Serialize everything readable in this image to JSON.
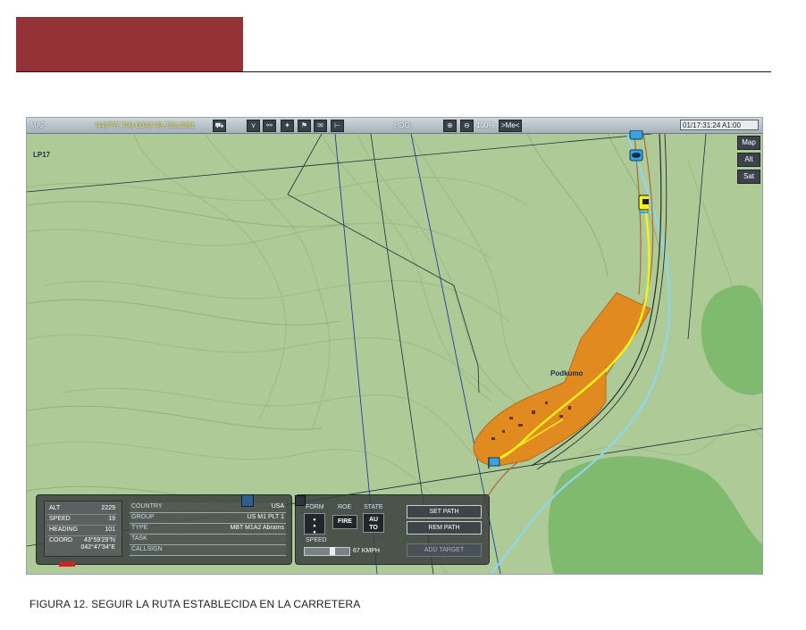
{
  "document": {
    "caption": "FIGURA 12.  SEGUIR LA RUTA ESTABLECIDA EN LA CARRETERA",
    "header_block_color": "#943337"
  },
  "topbar": {
    "map_label": "MAP",
    "coords": "N43°57.700 E042°45.733,2381",
    "hdg_label": "HDG:",
    "zoom": "100%",
    "me_button": ">Me<",
    "clock": "01/17:31:24 A1:00",
    "tool_icons": [
      "vehicle-icon",
      "waypoint-icon",
      "link-icon",
      "unit-icon",
      "flag-icon",
      "message-icon",
      "ruler-icon"
    ]
  },
  "map": {
    "lp_label": "LP17",
    "town_label": "Podkumo",
    "side_buttons": [
      "Map",
      "Alt",
      "Sat"
    ],
    "terrain_color": "#aecb97",
    "zone_color": "#e08a1f",
    "route_color": "#f6f01e",
    "river_color": "#8fd7ef"
  },
  "unit_panel": {
    "stats": [
      {
        "label": "ALT",
        "value": "2229"
      },
      {
        "label": "SPEED",
        "value": "19"
      },
      {
        "label": "HEADING",
        "value": "101"
      }
    ],
    "coord_label": "COORD",
    "coord_lat": "43°59'29\"N",
    "coord_lon": "042°47'34\"E",
    "info": [
      {
        "label": "COUNTRY",
        "value": "USA"
      },
      {
        "label": "GROUP",
        "value": "US M1 PLT 1"
      },
      {
        "label": "TYPE",
        "value": "MBT M1A2 Abrams"
      },
      {
        "label": "TASK",
        "value": ""
      },
      {
        "label": "CALLSIGN",
        "value": ""
      }
    ]
  },
  "orders_panel": {
    "form_label": "FORM",
    "roe_label": "ROE",
    "state_label": "STATE",
    "roe_value": "FIRE",
    "state_value_1": "AU",
    "state_value_2": "TO",
    "speed_label": "SPEED",
    "speed_value": "67 KMPH",
    "set_path": "SET PATH",
    "rem_path": "REM PATH",
    "add_target": "ADD TARGET"
  }
}
